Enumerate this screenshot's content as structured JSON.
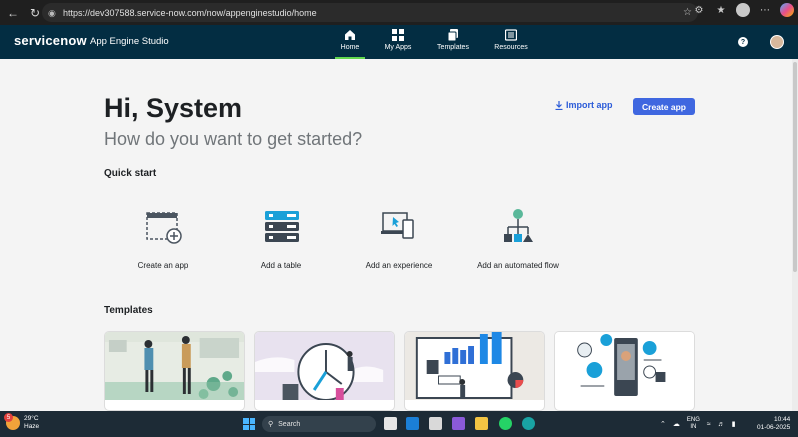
{
  "browser": {
    "url": "https://dev307588.service-now.com/now/appenginestudio/home",
    "back_icon": "back-arrow-icon",
    "reload_icon": "reload-icon"
  },
  "header": {
    "brand": "servicenow",
    "product": "App Engine Studio",
    "nav": [
      {
        "label": "Home",
        "icon": "home-icon",
        "active": true
      },
      {
        "label": "My Apps",
        "icon": "grid-icon",
        "active": false
      },
      {
        "label": "Templates",
        "icon": "templates-icon",
        "active": false
      },
      {
        "label": "Resources",
        "icon": "book-icon",
        "active": false
      }
    ],
    "help_glyph": "?"
  },
  "main": {
    "greeting": "Hi, System",
    "subtitle": "How do you want to get started?",
    "import_label": "Import app",
    "create_label": "Create app",
    "quick_start_title": "Quick start",
    "quick_start": [
      {
        "label": "Create an app",
        "icon": "create-app-icon"
      },
      {
        "label": "Add a table",
        "icon": "table-icon"
      },
      {
        "label": "Add an experience",
        "icon": "experience-icon"
      },
      {
        "label": "Add an automated flow",
        "icon": "flow-icon"
      }
    ],
    "templates_title": "Templates"
  },
  "taskbar": {
    "temp": "29°C",
    "weather": "Haze",
    "weather_badge": "5",
    "search_placeholder": "Search",
    "lang_top": "ENG",
    "lang_bottom": "IN",
    "time": "10:44",
    "date": "01-06-2025"
  },
  "colors": {
    "header_bg": "#032d42",
    "accent_green": "#62d84e",
    "primary_button": "#3f67e0",
    "link_blue": "#2b5bd8"
  }
}
